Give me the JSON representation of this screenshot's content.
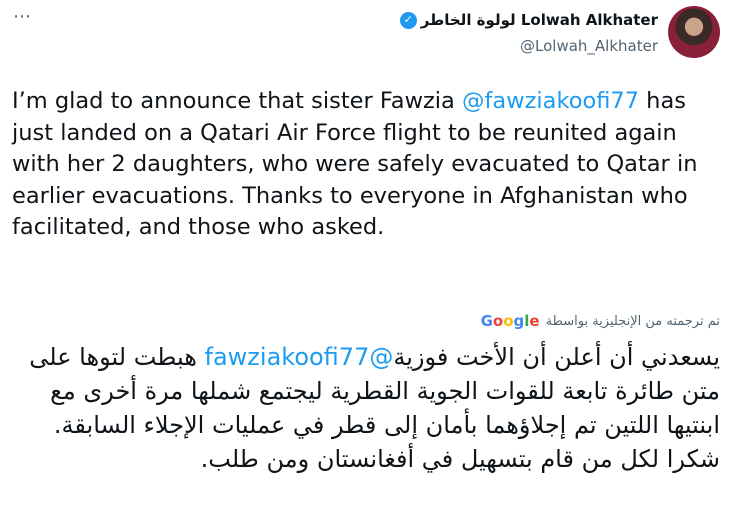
{
  "author": {
    "display_name": "لولوة الخاطر Lolwah Alkhater",
    "handle": "@Lolwah_Alkhater"
  },
  "more_options": "⋯",
  "tweet": {
    "en_before_mention": "I’m glad to announce that sister Fawzia ",
    "en_mention": "@fawziakoofi77",
    "en_after_mention": " has just landed on a Qatari Air Force flight to be reunited again with her 2 daughters, who were safely evacuated to Qatar in earlier evacuations. Thanks to everyone in Afghanistan who facilitated, and those who asked."
  },
  "translation": {
    "label": "تم ترجمته من الإنجليزية بواسطة",
    "provider": "Google",
    "ar_before_mention": "يسعدني أن أعلن أن الأخت فوزية",
    "ar_mention": "@fawziakoofi77",
    "ar_after_mention": " هبطت لتوها على متن طائرة تابعة للقوات الجوية القطرية ليجتمع شملها مرة أخرى مع ابنتيها اللتين تم إجلاؤهما بأمان إلى قطر في عمليات الإجلاء السابقة. شكرا لكل من قام بتسهيل في أفغانستان ومن طلب."
  },
  "colors": {
    "link": "#1d9bf0",
    "verified": "#1d9bf0",
    "secondary_text": "#536471"
  }
}
